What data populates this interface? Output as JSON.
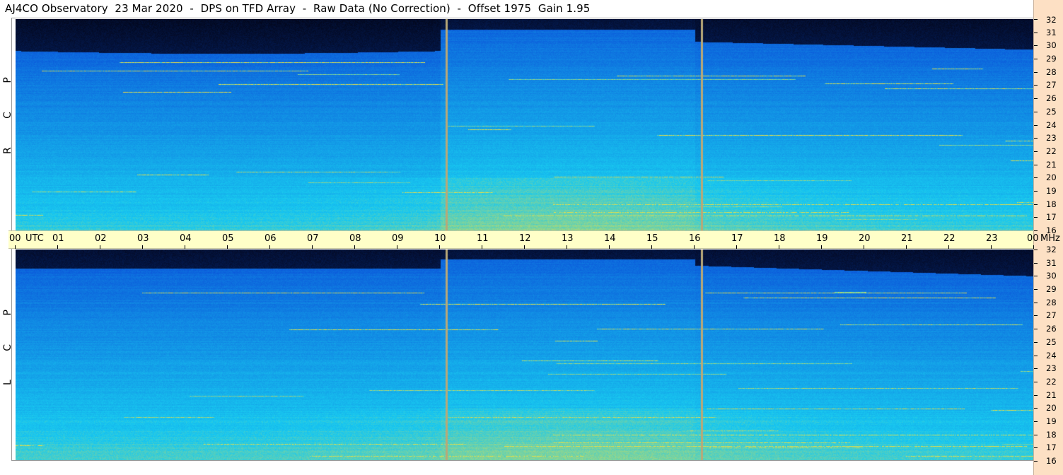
{
  "title": "AJ4CO Observatory  23 Mar 2020  -  DPS on TFD Array  -  Raw Data (No Correction)  -  Offset 1975  Gain 1.95",
  "chart_data": {
    "type": "heatmap",
    "title": "AJ4CO Observatory  23 Mar 2020  -  DPS on TFD Array  -  Raw Data (No Correction)  -  Offset 1975  Gain 1.95",
    "x_axis": {
      "unit_label": "UTC",
      "tick_labels": [
        "00",
        "01",
        "02",
        "03",
        "04",
        "05",
        "06",
        "07",
        "08",
        "09",
        "10",
        "11",
        "12",
        "13",
        "14",
        "15",
        "16",
        "17",
        "18",
        "19",
        "20",
        "21",
        "22",
        "23",
        "00"
      ],
      "range_hours": [
        0,
        24
      ]
    },
    "y_axis": {
      "unit_label": "MHz",
      "tick_labels": [
        "16",
        "17",
        "18",
        "19",
        "20",
        "21",
        "22",
        "23",
        "24",
        "25",
        "26",
        "27",
        "28",
        "29",
        "30",
        "31",
        "32"
      ],
      "range_mhz": [
        16,
        32
      ]
    },
    "panels": [
      {
        "name": "RCP",
        "label": "R C P"
      },
      {
        "name": "LCP",
        "label": "L C P"
      }
    ],
    "markers_utc_hours": [
      10.15,
      16.15
    ],
    "colors": {
      "low": "#02061a",
      "mid": "#0a4ed8",
      "high": "#18c8f0",
      "hot": "#f0e040",
      "marker": "#b8a878",
      "time_axis_bg": "#ffffc8",
      "freq_axis_bg": "#fde0c4"
    }
  }
}
